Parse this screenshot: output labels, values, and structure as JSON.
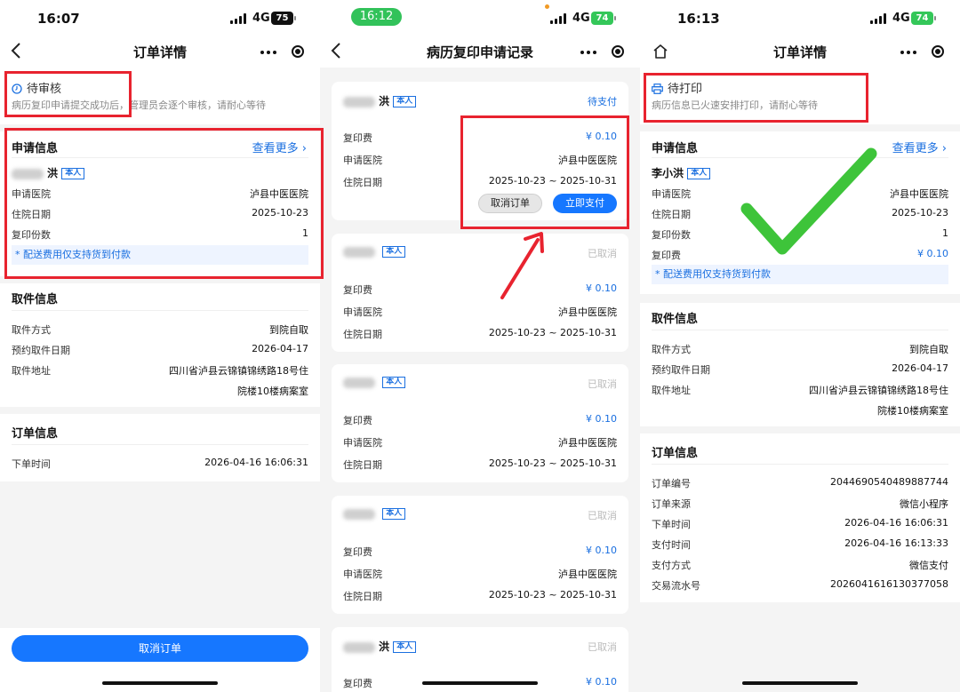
{
  "screens": [
    {
      "status": {
        "time": "16:07",
        "network": "4G",
        "battery": "75"
      },
      "nav": {
        "title": "订单详情"
      },
      "order_status": {
        "title": "待审核",
        "desc": "病历复印申请提交成功后，管理员会逐个审核，请耐心等待"
      },
      "application": {
        "title": "申请信息",
        "more": "查看更多",
        "name_suffix": "洪",
        "badge": "本人",
        "rows": [
          {
            "label": "申请医院",
            "value": "泸县中医医院"
          },
          {
            "label": "住院日期",
            "value": "2025-10-23"
          },
          {
            "label": "复印份数",
            "value": "1"
          }
        ],
        "note": "* 配送费用仅支持货到付款"
      },
      "pickup": {
        "title": "取件信息",
        "rows": [
          {
            "label": "取件方式",
            "value": "到院自取"
          },
          {
            "label": "预约取件日期",
            "value": "2026-04-17"
          },
          {
            "label": "取件地址",
            "value": "四川省泸县云锦镇锦绣路18号住"
          }
        ],
        "address_line2": "院楼10楼病案室"
      },
      "order": {
        "title": "订单信息",
        "rows": [
          {
            "label": "下单时间",
            "value": "2026-04-16 16:06:31"
          }
        ]
      },
      "bottom_button": "取消订单"
    },
    {
      "status": {
        "time": "16:12",
        "network": "4G",
        "battery": "74"
      },
      "nav": {
        "title": "病历复印申请记录"
      },
      "labels": {
        "fee": "复印费",
        "hospital": "申请医院",
        "date": "住院日期"
      },
      "records": [
        {
          "name_suffix": "洪",
          "badge": "本人",
          "status": "待支付",
          "fee": "¥ 0.10",
          "hospital": "泸县中医医院",
          "date": "2025-10-23 ~ 2025-10-31",
          "cancel_label": "取消订单",
          "pay_label": "立即支付"
        },
        {
          "name_suffix": "",
          "badge": "本人",
          "status": "已取消",
          "fee": "¥ 0.10",
          "hospital": "泸县中医医院",
          "date": "2025-10-23 ~ 2025-10-31"
        },
        {
          "name_suffix": "",
          "badge": "本人",
          "status": "已取消",
          "fee": "¥ 0.10",
          "hospital": "泸县中医医院",
          "date": "2025-10-23 ~ 2025-10-31"
        },
        {
          "name_suffix": "",
          "badge": "本人",
          "status": "已取消",
          "fee": "¥ 0.10",
          "hospital": "泸县中医医院",
          "date": "2025-10-23 ~ 2025-10-31"
        },
        {
          "name_suffix": "洪",
          "badge": "本人",
          "status": "已取消",
          "fee": "¥ 0.10"
        }
      ]
    },
    {
      "status": {
        "time": "16:13",
        "network": "4G",
        "battery": "74"
      },
      "nav": {
        "title": "订单详情"
      },
      "order_status": {
        "title": "待打印",
        "desc": "病历信息已火速安排打印，请耐心等待"
      },
      "application": {
        "title": "申请信息",
        "more": "查看更多",
        "name": "李小洪",
        "badge": "本人",
        "rows": [
          {
            "label": "申请医院",
            "value": "泸县中医医院"
          },
          {
            "label": "住院日期",
            "value": "2025-10-23"
          },
          {
            "label": "复印份数",
            "value": "1"
          },
          {
            "label": "复印费",
            "value": "¥ 0.10"
          }
        ],
        "note": "* 配送费用仅支持货到付款"
      },
      "pickup": {
        "title": "取件信息",
        "rows": [
          {
            "label": "取件方式",
            "value": "到院自取"
          },
          {
            "label": "预约取件日期",
            "value": "2026-04-17"
          },
          {
            "label": "取件地址",
            "value": "四川省泸县云锦镇锦绣路18号住"
          }
        ],
        "address_line2": "院楼10楼病案室"
      },
      "order": {
        "title": "订单信息",
        "rows": [
          {
            "label": "订单编号",
            "value": "2044690540489887744"
          },
          {
            "label": "订单来源",
            "value": "微信小程序"
          },
          {
            "label": "下单时间",
            "value": "2026-04-16 16:06:31"
          },
          {
            "label": "支付时间",
            "value": "2026-04-16 16:13:33"
          },
          {
            "label": "支付方式",
            "value": "微信支付"
          },
          {
            "label": "交易流水号",
            "value": "20260416161303770​58"
          }
        ]
      }
    }
  ],
  "colors": {
    "accent": "#1677ff",
    "highlight": "#e8232f",
    "check": "#3ec43a",
    "time_pill": "#32c25a"
  }
}
